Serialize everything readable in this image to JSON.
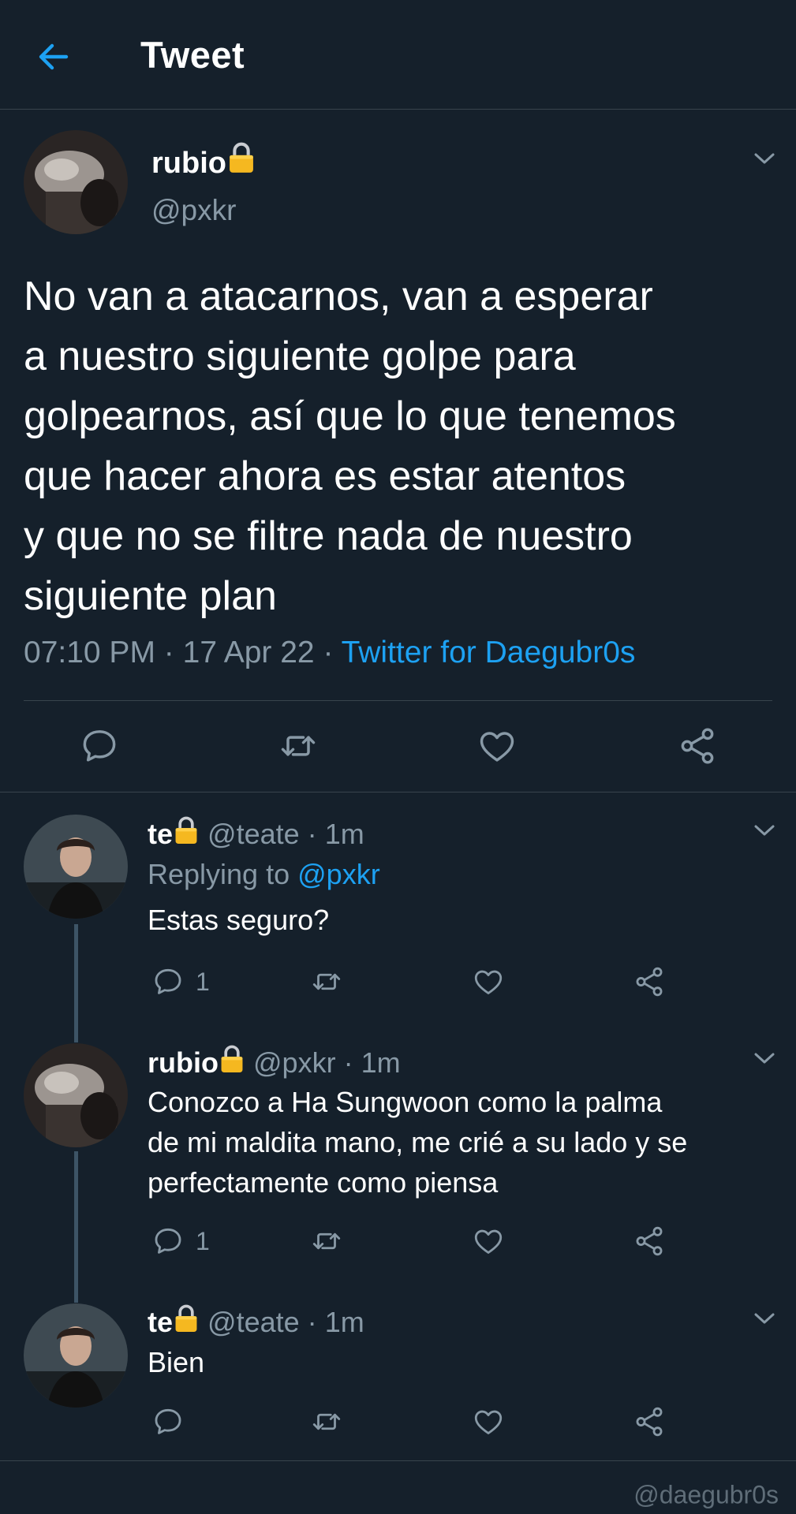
{
  "header": {
    "title": "Tweet"
  },
  "main_tweet": {
    "name": "rubio",
    "handle": "@pxkr",
    "lines": [
      "No van a atacarnos, van a esperar",
      "a nuestro siguiente golpe para",
      "golpearnos, así que lo que tenemos",
      "que hacer ahora es estar atentos",
      "y que no se filtre nada de nuestro",
      "siguiente plan"
    ],
    "time": "07:10 PM",
    "date": "17 Apr 22",
    "source": "Twitter for Daegubr0s"
  },
  "replies": [
    {
      "name": "te",
      "handle": "@teate",
      "age": "1m",
      "replying_label": "Replying to",
      "replying_to": "@pxkr",
      "lines": [
        "Estas seguro?"
      ],
      "reply_count": "1"
    },
    {
      "name": "rubio",
      "handle": "@pxkr",
      "age": "1m",
      "lines": [
        "Conozco a Ha Sungwoon como la palma",
        "de mi maldita mano, me crié a su lado y se",
        "perfectamente como piensa"
      ],
      "reply_count": "1"
    },
    {
      "name": "te",
      "handle": "@teate",
      "age": "1m",
      "lines": [
        "Bien"
      ],
      "reply_count": ""
    }
  ],
  "separator": "·",
  "watermark": "@daegubr0s",
  "colors": {
    "background": "#15202b",
    "accent": "#1da1f2",
    "muted": "#8899a6",
    "lock": "#f5b820"
  }
}
